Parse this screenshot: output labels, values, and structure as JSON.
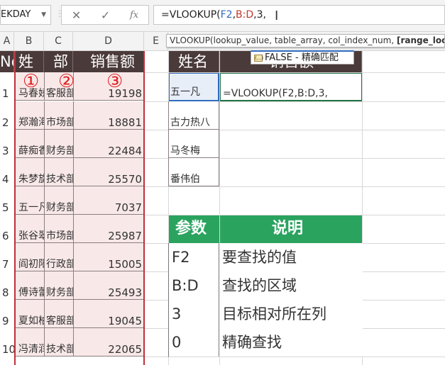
{
  "namebox": {
    "value": "EKDAY"
  },
  "formula": {
    "prefix": "=VLOOKUP(",
    "ref1": "F2",
    "sep1": ",",
    "ref2": "B:D",
    "rest": ",3,"
  },
  "columns": [
    "A",
    "B",
    "C",
    "D",
    "E"
  ],
  "header": {
    "no": "No",
    "name": "姓名",
    "dept": "部门",
    "sales": "销售额"
  },
  "annotations": [
    "①",
    "②",
    "③"
  ],
  "rows": [
    {
      "no": "1",
      "name": "马春娇",
      "dept": "客服部",
      "sales": "19198"
    },
    {
      "no": "2",
      "name": "郑瀚海",
      "dept": "市场部",
      "sales": "18881"
    },
    {
      "no": "3",
      "name": "薛痴香",
      "dept": "财务部",
      "sales": "22484"
    },
    {
      "no": "4",
      "name": "朱梦旋",
      "dept": "技术部",
      "sales": "25570"
    },
    {
      "no": "5",
      "name": "五一凡",
      "dept": "财务部",
      "sales": "7037"
    },
    {
      "no": "6",
      "name": "张谷翠",
      "dept": "市场部",
      "sales": "25987"
    },
    {
      "no": "7",
      "name": "阎初阳",
      "dept": "行政部",
      "sales": "15005"
    },
    {
      "no": "8",
      "name": "傅诗蕾",
      "dept": "财务部",
      "sales": "25493"
    },
    {
      "no": "9",
      "name": "夏如柏",
      "dept": "客服部",
      "sales": "19045"
    },
    {
      "no": "10",
      "name": "冯清润",
      "dept": "技术部",
      "sales": "22065"
    }
  ],
  "lookup": {
    "header_name": "姓名",
    "header_sales": "销售额",
    "names": [
      "五一凡",
      "古力热八",
      "马冬梅",
      "番伟伯"
    ],
    "editing": "=VLOOKUP(F2,B:D,3,"
  },
  "tooltip": {
    "text": "VLOOKUP(lookup_value, table_array, col_index_num, ",
    "bold": "[range_lookup]"
  },
  "autocomplete": {
    "item": "FALSE - 精确匹配"
  },
  "params": {
    "h1": "参数",
    "h2": "说明",
    "rows": [
      {
        "p": "F2",
        "d": "要查找的值"
      },
      {
        "p": "B:D",
        "d": "查找的区域"
      },
      {
        "p": "3",
        "d": "目标相对所在列"
      },
      {
        "p": "0",
        "d": "精确查找"
      }
    ]
  },
  "colors": {
    "header": "#4b3a3a",
    "green": "#2aa35f",
    "highlight": "#f8e8e8",
    "border_red": "#c0303a"
  }
}
